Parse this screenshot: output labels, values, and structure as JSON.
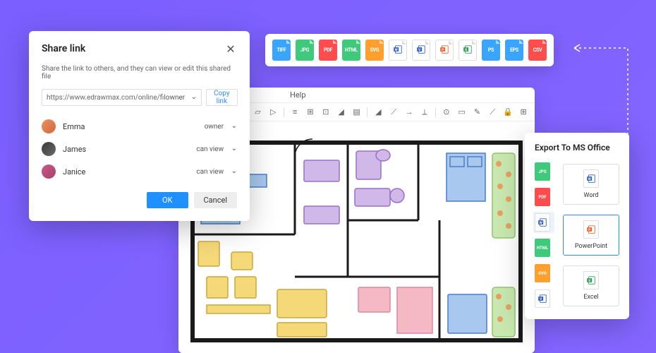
{
  "share_dialog": {
    "title": "Share link",
    "desc": "Share the link to others, and they can view or edit this shared file",
    "url": "https://www.edrawmax.com/online/fil",
    "url_role": "owner",
    "copy_label": "Copy link",
    "users": [
      {
        "name": "Emma",
        "role": "owner"
      },
      {
        "name": "James",
        "role": "can view"
      },
      {
        "name": "Janice",
        "role": "can view"
      }
    ],
    "ok": "OK",
    "cancel": "Cancel"
  },
  "canvas": {
    "menu": "Help"
  },
  "format_bar": {
    "items": [
      {
        "label": "TIFF",
        "color": "#3aa5ff",
        "type": "text"
      },
      {
        "label": "JPG",
        "color": "#3fc97a",
        "type": "text"
      },
      {
        "label": "PDF",
        "color": "#ff4d4d",
        "type": "text"
      },
      {
        "label": "HTML",
        "color": "#3fc97a",
        "type": "text"
      },
      {
        "label": "SVG",
        "color": "#ffa02e",
        "type": "text"
      },
      {
        "label": "W",
        "color": "#2e5fc5",
        "type": "icon",
        "icon": "word"
      },
      {
        "label": "V",
        "color": "#2e5fc5",
        "type": "icon",
        "icon": "visio"
      },
      {
        "label": "P",
        "color": "#e8662e",
        "type": "icon",
        "icon": "ppt"
      },
      {
        "label": "X",
        "color": "#2e9f5a",
        "type": "icon",
        "icon": "excel"
      },
      {
        "label": "PS",
        "color": "#3aa5ff",
        "type": "text"
      },
      {
        "label": "EPS",
        "color": "#3aa5ff",
        "type": "text"
      },
      {
        "label": "CSV",
        "color": "#ff4d4d",
        "type": "text"
      }
    ]
  },
  "export_panel": {
    "title": "Export To MS Office",
    "left_items": [
      {
        "label": "JPG",
        "color": "#3fc97a"
      },
      {
        "label": "PDF",
        "color": "#ff4d4d"
      },
      {
        "label": "W",
        "color": "#2e5fc5",
        "icon": "word",
        "selected": true
      },
      {
        "label": "HTML",
        "color": "#3fc97a"
      },
      {
        "label": "SVG",
        "color": "#ffa02e"
      },
      {
        "label": "V",
        "color": "#2e5fc5",
        "icon": "visio"
      }
    ],
    "cards": [
      {
        "label": "Word",
        "color": "#2e5fc5",
        "icon": "word"
      },
      {
        "label": "PowerPoint",
        "color": "#e8662e",
        "icon": "ppt",
        "selected": true
      },
      {
        "label": "Excel",
        "color": "#2e9f5a",
        "icon": "excel"
      }
    ]
  }
}
